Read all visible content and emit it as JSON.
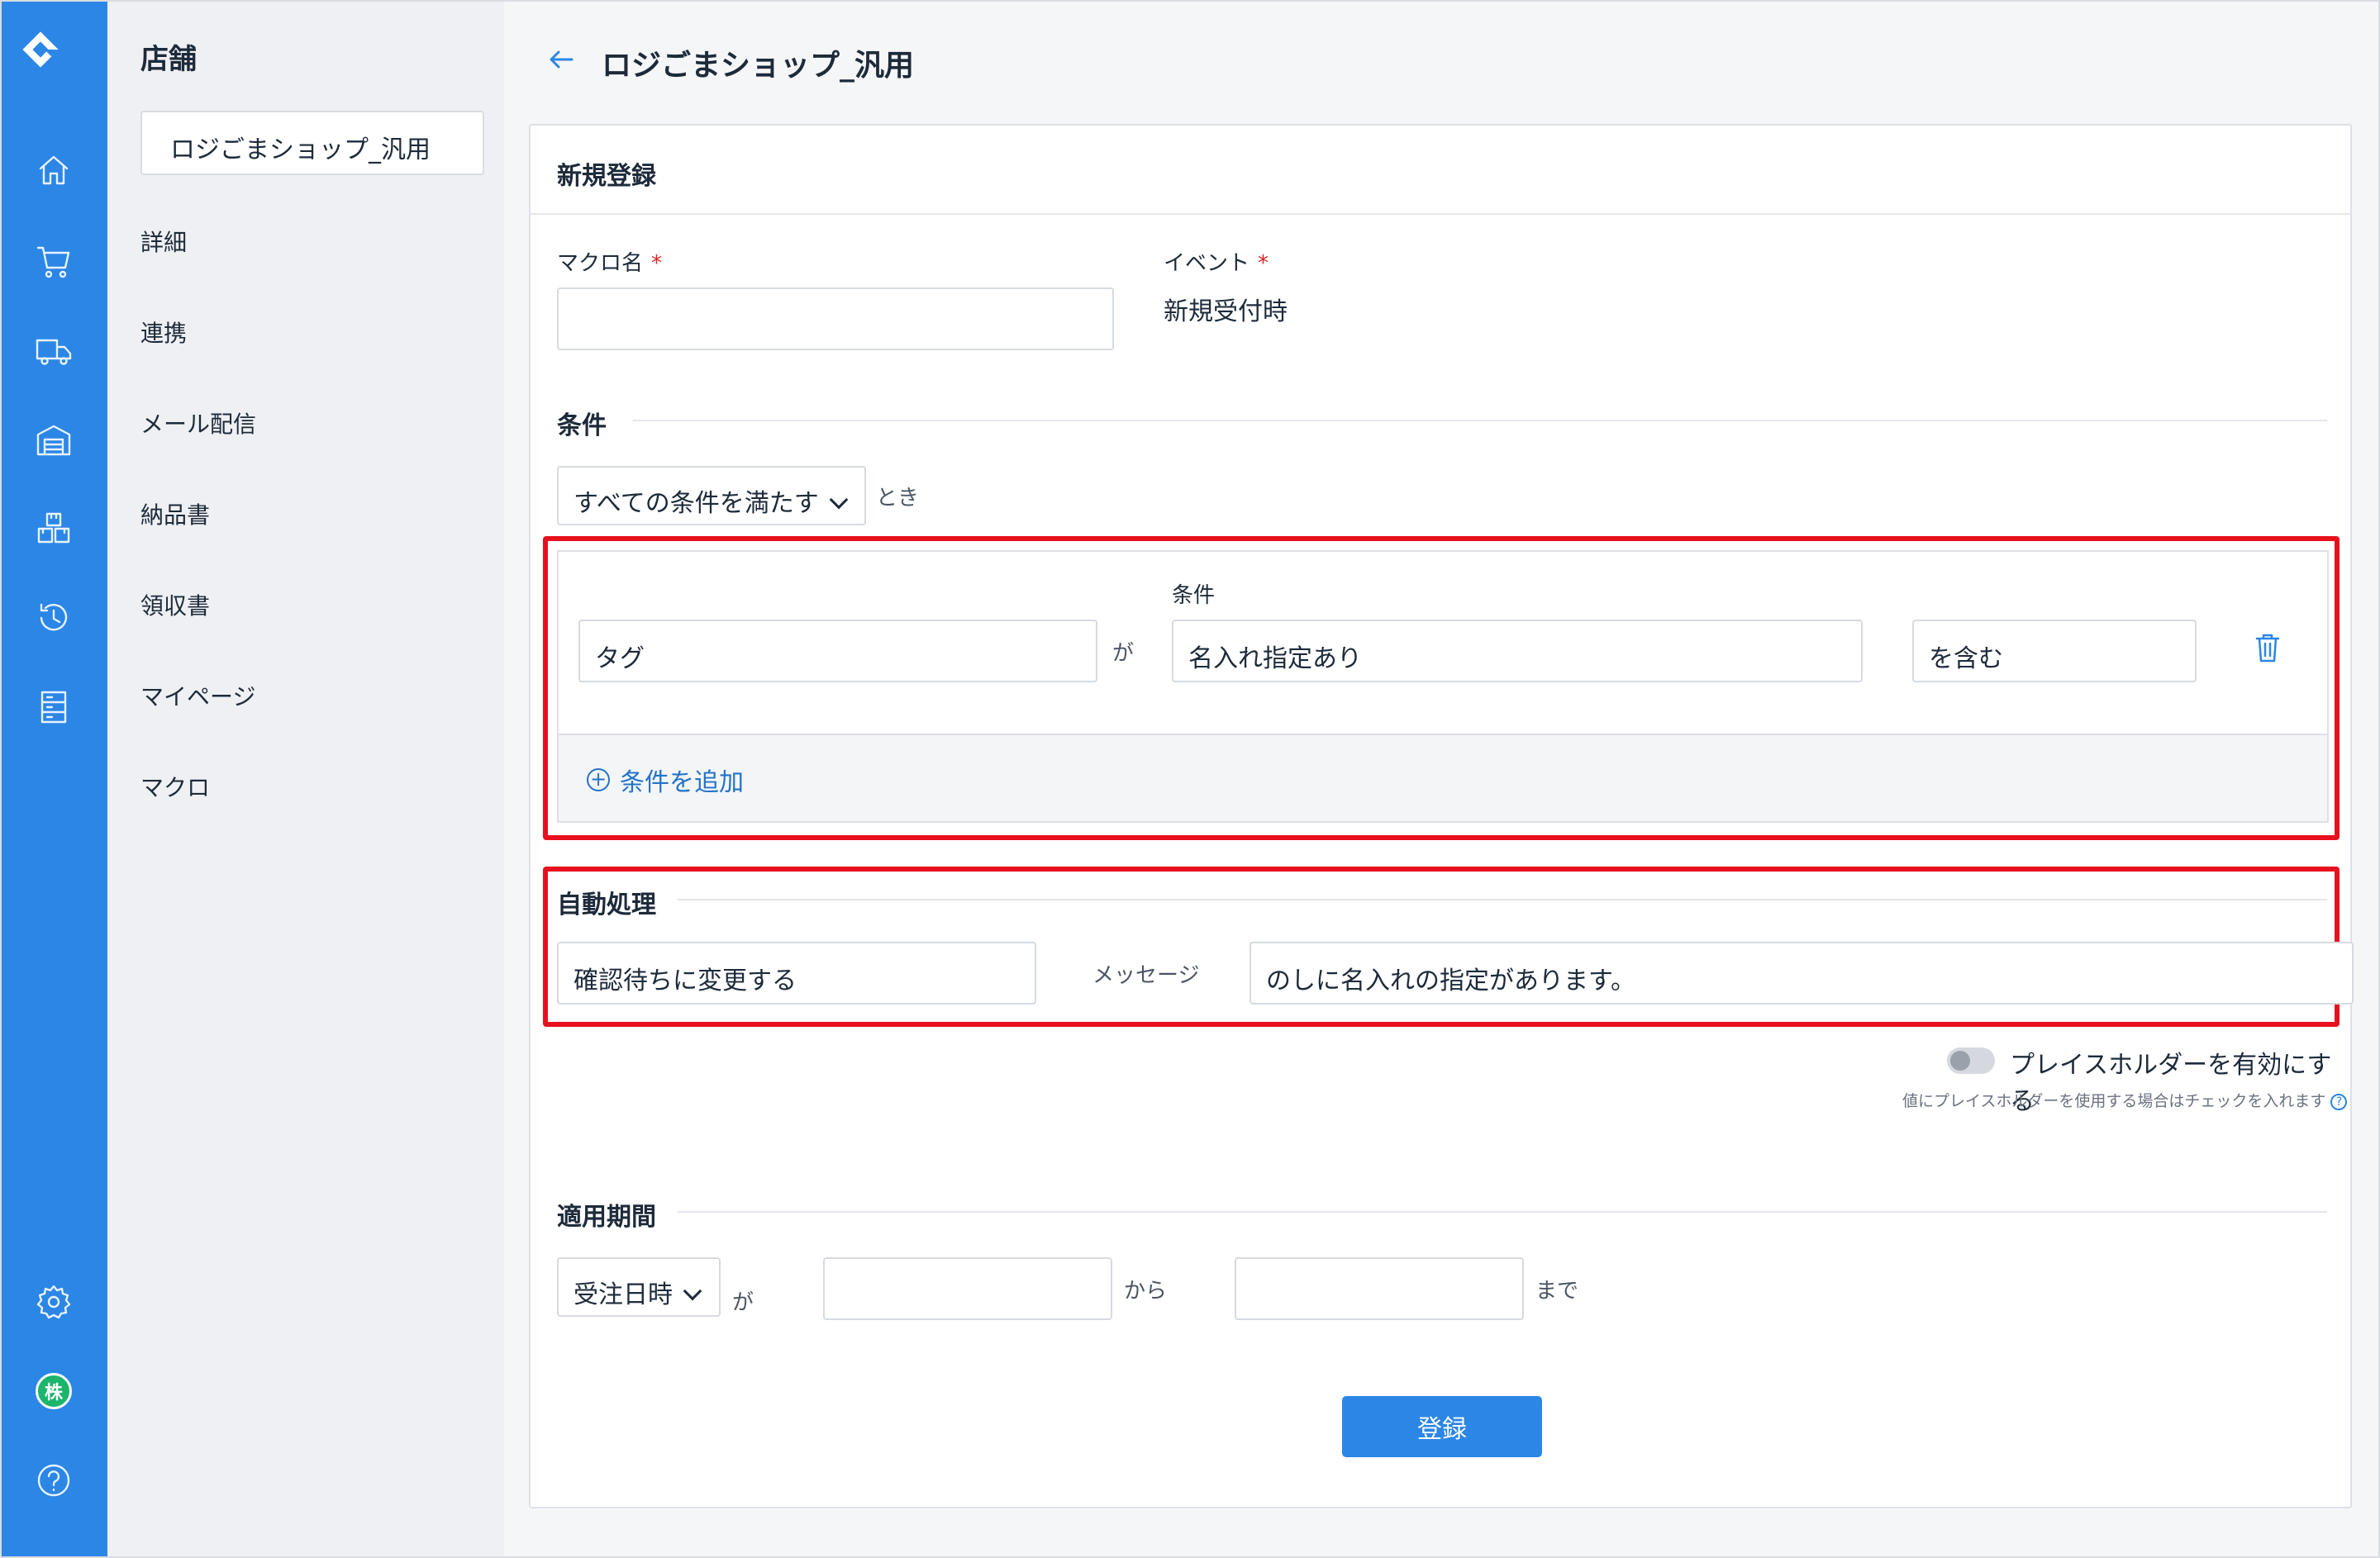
{
  "colors": {
    "rail": "#2b86e6",
    "accent": "#2b86e6",
    "highlight": "#e8101c",
    "avatar": "#1bb56b"
  },
  "rail": {
    "icons": [
      "logo-icon",
      "home-icon",
      "cart-icon",
      "truck-icon",
      "warehouse-icon",
      "boxes-icon",
      "history-icon",
      "database-icon",
      "gear-icon",
      "avatar",
      "help-icon"
    ],
    "avatar_text": "株",
    "help_text": "?"
  },
  "sidebar": {
    "title": "店舗",
    "shop_name": "ロジごまショップ_汎用",
    "items": [
      "詳細",
      "連携",
      "メール配信",
      "納品書",
      "領収書",
      "マイページ",
      "マクロ"
    ]
  },
  "header": {
    "title": "ロジごまショップ_汎用"
  },
  "form": {
    "card_title": "新規登録",
    "macro_name": {
      "label": "マクロ名",
      "required_mark": "*",
      "value": ""
    },
    "event": {
      "label": "イベント",
      "required_mark": "*",
      "value": "新規受付時"
    },
    "conditions": {
      "section_title": "条件",
      "match_select": "すべての条件を満たす",
      "match_suffix": "とき",
      "column_label": "条件",
      "field": "タグ",
      "connector": "が",
      "value": "名入れ指定あり",
      "operator": "を含む",
      "add_label": "条件を追加"
    },
    "auto_process": {
      "section_title": "自動処理",
      "action": "確認待ちに変更する",
      "message_label": "メッセージ",
      "message_value": "のしに名入れの指定があります。"
    },
    "placeholder": {
      "toggle_label": "プレイスホルダーを有効にする",
      "hint": "値にプレイスホルダーを使用する場合はチェックを入れます",
      "enabled": false
    },
    "period": {
      "section_title": "適用期間",
      "basis_select": "受注日時",
      "connector": "が",
      "from_value": "",
      "from_label": "から",
      "to_value": "",
      "to_label": "まで"
    },
    "submit_label": "登録"
  }
}
